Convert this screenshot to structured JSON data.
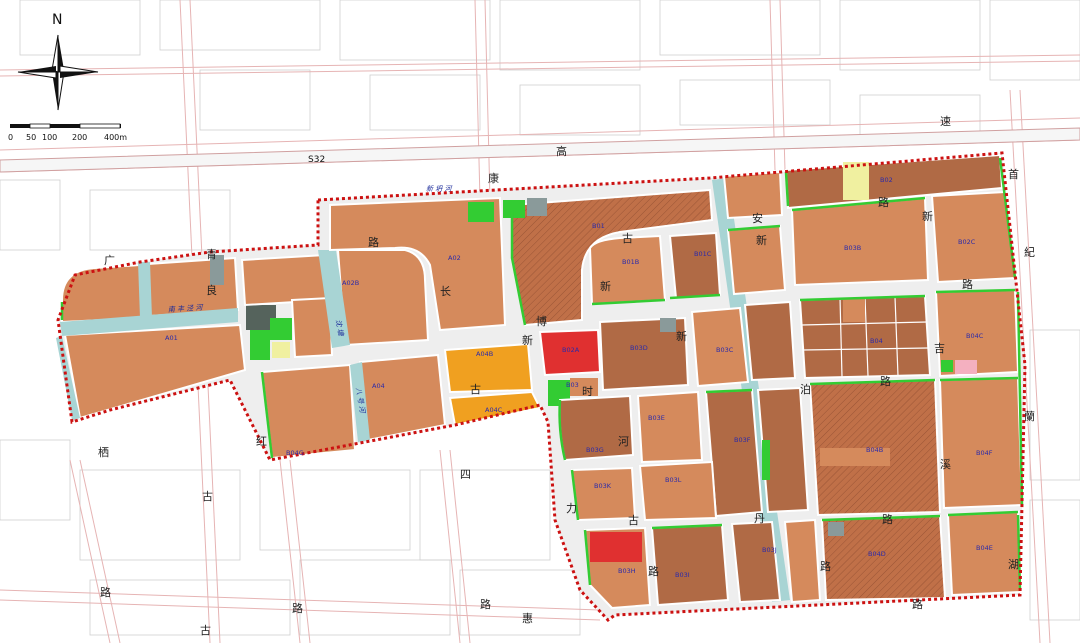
{
  "compass": {
    "north": "N"
  },
  "scale": {
    "ticks": [
      "0",
      "50",
      "100",
      "200",
      "400m"
    ]
  },
  "highway": {
    "name": "S32"
  },
  "road_chars": [
    {
      "id": "gao",
      "text": "高"
    },
    {
      "id": "su",
      "text": "速"
    },
    {
      "id": "kang",
      "text": "康"
    },
    {
      "id": "an",
      "text": "安"
    },
    {
      "id": "gu1",
      "text": "古"
    },
    {
      "id": "gu2",
      "text": "古"
    },
    {
      "id": "gu3",
      "text": "古"
    },
    {
      "id": "gu4",
      "text": "古"
    },
    {
      "id": "gu5",
      "text": "古"
    },
    {
      "id": "lu1",
      "text": "路"
    },
    {
      "id": "lu2",
      "text": "路"
    },
    {
      "id": "lu3",
      "text": "路"
    },
    {
      "id": "lu4",
      "text": "路"
    },
    {
      "id": "lu5",
      "text": "路"
    },
    {
      "id": "lu6",
      "text": "路"
    },
    {
      "id": "lu7",
      "text": "路"
    },
    {
      "id": "lu8",
      "text": "路"
    },
    {
      "id": "lu9",
      "text": "路"
    },
    {
      "id": "lu10",
      "text": "路"
    },
    {
      "id": "lu11",
      "text": "路"
    },
    {
      "id": "xin1",
      "text": "新"
    },
    {
      "id": "xin2",
      "text": "新"
    },
    {
      "id": "xin3",
      "text": "新"
    },
    {
      "id": "xin4",
      "text": "新"
    },
    {
      "id": "xin5",
      "text": "新"
    },
    {
      "id": "bo",
      "text": "博"
    },
    {
      "id": "liang",
      "text": "良"
    },
    {
      "id": "qing",
      "text": "青"
    },
    {
      "id": "guang",
      "text": "广"
    },
    {
      "id": "hong",
      "text": "红"
    },
    {
      "id": "si",
      "text": "四"
    },
    {
      "id": "shi",
      "text": "时"
    },
    {
      "id": "dan",
      "text": "丹"
    },
    {
      "id": "li",
      "text": "力"
    },
    {
      "id": "ji",
      "text": "吉"
    },
    {
      "id": "bo2",
      "text": "泊"
    },
    {
      "id": "lan",
      "text": "蘭"
    },
    {
      "id": "ji2",
      "text": "紀"
    },
    {
      "id": "xi",
      "text": "溪"
    },
    {
      "id": "hui",
      "text": "惠"
    },
    {
      "id": "shou",
      "text": "首"
    },
    {
      "id": "qi",
      "text": "栖"
    },
    {
      "id": "he",
      "text": "河"
    },
    {
      "id": "chang",
      "text": "长"
    },
    {
      "id": "hu",
      "text": "湖"
    }
  ],
  "rivers": [
    {
      "id": "xinxing",
      "text": "新 坍 河"
    },
    {
      "id": "nanfeng",
      "text": "南 丰 泾 河"
    },
    {
      "id": "river_v1",
      "text": "沈 塘"
    },
    {
      "id": "river_v2",
      "text": "八 号 河"
    }
  ],
  "zones": [
    {
      "id": "A01",
      "text": "A01"
    },
    {
      "id": "A02",
      "text": "A02"
    },
    {
      "id": "A02B",
      "text": "A02B"
    },
    {
      "id": "A04",
      "text": "A04"
    },
    {
      "id": "A04B",
      "text": "A04B"
    },
    {
      "id": "A04C",
      "text": "A04C"
    },
    {
      "id": "B01",
      "text": "B01"
    },
    {
      "id": "B01B",
      "text": "B01B"
    },
    {
      "id": "B01C",
      "text": "B01C"
    },
    {
      "id": "B02",
      "text": "B02"
    },
    {
      "id": "B02C",
      "text": "B02C"
    },
    {
      "id": "B02A",
      "text": "B02A"
    },
    {
      "id": "B03",
      "text": "B03"
    },
    {
      "id": "B03B",
      "text": "B03B"
    },
    {
      "id": "B03C",
      "text": "B03C"
    },
    {
      "id": "B03D",
      "text": "B03D"
    },
    {
      "id": "B03E",
      "text": "B03E"
    },
    {
      "id": "B03F",
      "text": "B03F"
    },
    {
      "id": "B03G",
      "text": "B03G"
    },
    {
      "id": "B03H",
      "text": "B03H"
    },
    {
      "id": "B03I",
      "text": "B03I"
    },
    {
      "id": "B03J",
      "text": "B03J"
    },
    {
      "id": "B03K",
      "text": "B03K"
    },
    {
      "id": "B03L",
      "text": "B03L"
    },
    {
      "id": "B04",
      "text": "B04"
    },
    {
      "id": "B04B",
      "text": "B04B"
    },
    {
      "id": "B04C",
      "text": "B04C"
    },
    {
      "id": "B04D",
      "text": "B04D"
    },
    {
      "id": "B04E",
      "text": "B04E"
    },
    {
      "id": "B04F",
      "text": "B04F"
    },
    {
      "id": "B04G",
      "text": "B04G"
    }
  ],
  "colors": {
    "residential": "#d58a5c",
    "residential_dark": "#b06a45",
    "commercial": "#f0a020",
    "public": "#e03030",
    "green": "#33cc33",
    "water": "#a8d4d4",
    "gray": "#8a9a9a",
    "yellow": "#f0f0a0",
    "pink": "#f4b0c0",
    "boundary": "#cc1111",
    "road_line": "#e0a8a8",
    "label_blue": "#2a2aaa"
  }
}
